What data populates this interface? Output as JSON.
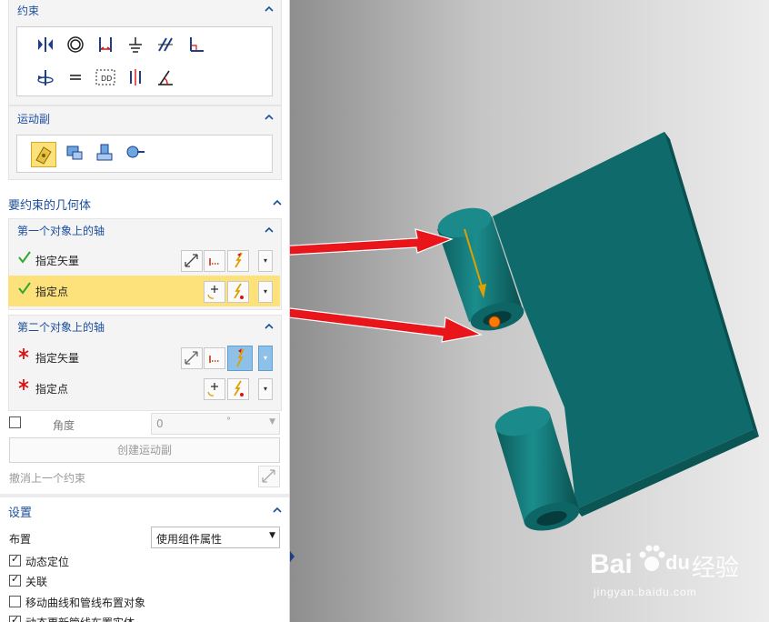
{
  "panel": {
    "constraints": {
      "title": "约束"
    },
    "motion_pair": {
      "title": "运动副"
    },
    "geometry": {
      "title": "要约束的几何体",
      "first_axis": {
        "title": "第一个对象上的轴",
        "specify_vector": "指定矢量",
        "specify_point": "指定点"
      },
      "second_axis": {
        "title": "第二个对象上的轴",
        "specify_vector": "指定矢量",
        "specify_point": "指定点"
      },
      "angle": {
        "label": "角度",
        "value": "0",
        "unit": "°"
      },
      "create_button": "创建运动副",
      "undo_label": "撤消上一个约束"
    },
    "settings": {
      "title": "设置",
      "layout_label": "布置",
      "layout_value": "使用组件属性",
      "checkboxes": [
        {
          "label": "动态定位",
          "checked": true
        },
        {
          "label": "关联",
          "checked": true
        },
        {
          "label": "移动曲线和管线布置对象",
          "checked": false
        },
        {
          "label": "动态更新管线布置实体",
          "checked": true
        }
      ]
    }
  },
  "watermark": {
    "brand": "Bai",
    "brand2": "du",
    "service": "经验",
    "url": "jingyan.baidu.com"
  },
  "colors": {
    "accent_blue": "#1a4d9e",
    "highlight": "#fde17a",
    "part_teal": "#0f6b6b",
    "arrow_red": "#e8161b"
  },
  "icons": [
    "touch-align-icon",
    "concentric-icon",
    "distance-icon",
    "fix-icon",
    "parallel-icon",
    "perpendicular-icon",
    "align-axis-icon",
    "equal-icon",
    "fit-icon",
    "center-icon",
    "angle-icon",
    "hinge-joint-icon",
    "slider-joint-icon",
    "cylinder-joint-icon",
    "ball-joint-icon"
  ]
}
